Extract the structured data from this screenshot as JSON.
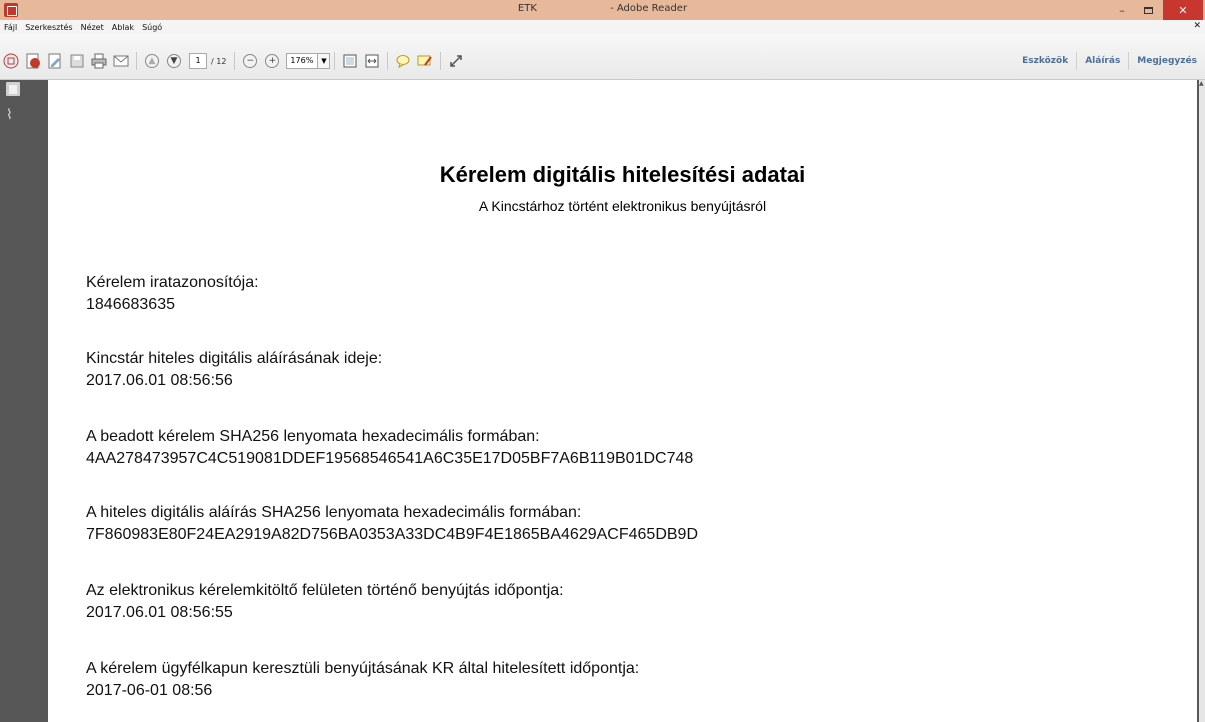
{
  "window": {
    "title_left": "ETK",
    "title_right": "- Adobe Reader"
  },
  "menu": [
    "Fájl",
    "Szerkesztés",
    "Nézet",
    "Ablak",
    "Súgó"
  ],
  "toolbar": {
    "page_current": "1",
    "page_total": "/ 12",
    "zoom": "176%",
    "right_links": [
      "Eszközök",
      "Aláírás",
      "Megjegyzés"
    ]
  },
  "document": {
    "title": "Kérelem digitális hitelesítési adatai",
    "subtitle": "A Kincstárhoz történt elektronikus benyújtásról",
    "fields": [
      {
        "label": "Kérelem iratazonosítója:",
        "value": "1846683635"
      },
      {
        "label": "Kincstár hiteles digitális aláírásának ideje:",
        "value": "2017.06.01 08:56:56"
      },
      {
        "label": "A beadott kérelem SHA256 lenyomata hexadecimális formában:",
        "value": "4AA278473957C4C519081DDEF19568546541A6C35E17D05BF7A6B119B01DC748"
      },
      {
        "label": "A hiteles digitális aláírás SHA256 lenyomata hexadecimális formában:",
        "value": "7F860983E80F24EA2919A82D756BA0353A33DC4B9F4E1865BA4629ACF465DB9D"
      },
      {
        "label": "Az elektronikus kérelemkitöltő felületen történő benyújtás időpontja:",
        "value": "2017.06.01 08:56:55"
      },
      {
        "label": "A kérelem ügyfélkapun keresztüli benyújtásának KR által hitelesített időpontja:",
        "value": "2017-06-01 08:56"
      }
    ]
  },
  "colors": {
    "titlebar": "#e8b89a",
    "close_button": "#c7372f",
    "link_blue": "#4e6f96",
    "sidebar": "#575757"
  }
}
